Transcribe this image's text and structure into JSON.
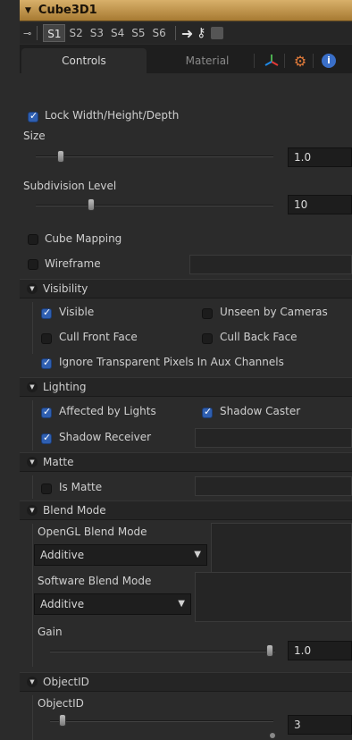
{
  "header": {
    "title": "Cube3D1"
  },
  "toolbar": {
    "slots": [
      "S1",
      "S2",
      "S3",
      "S4",
      "S5",
      "S6"
    ],
    "active_slot": "S1"
  },
  "tabs": {
    "controls": "Controls",
    "material": "Material"
  },
  "controls": {
    "lock_whd": {
      "label": "Lock Width/Height/Depth",
      "checked": true
    },
    "size": {
      "label": "Size",
      "value": "1.0"
    },
    "subdivision": {
      "label": "Subdivision Level",
      "value": "10"
    },
    "cube_mapping": {
      "label": "Cube Mapping",
      "checked": false
    },
    "wireframe": {
      "label": "Wireframe",
      "checked": false
    }
  },
  "visibility": {
    "title": "Visibility",
    "visible": "Visible",
    "unseen": "Unseen by Cameras",
    "cull_front": "Cull Front Face",
    "cull_back": "Cull Back Face",
    "ignore_transparent": "Ignore Transparent Pixels In Aux Channels"
  },
  "lighting": {
    "title": "Lighting",
    "affected": "Affected by Lights",
    "shadow_caster": "Shadow Caster",
    "shadow_receiver": "Shadow Receiver"
  },
  "matte": {
    "title": "Matte",
    "is_matte": "Is Matte"
  },
  "blend": {
    "title": "Blend Mode",
    "opengl_label": "OpenGL Blend Mode",
    "opengl_value": "Additive",
    "software_label": "Software Blend Mode",
    "software_value": "Additive",
    "gain_label": "Gain",
    "gain_value": "1.0"
  },
  "objectid": {
    "title": "ObjectID",
    "label": "ObjectID",
    "value": "3"
  }
}
